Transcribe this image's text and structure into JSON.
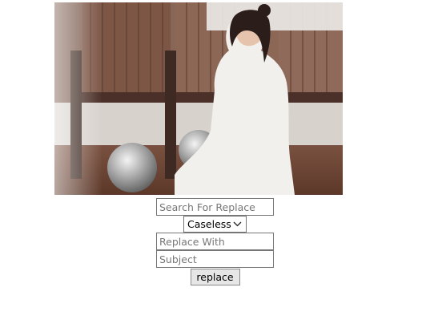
{
  "form": {
    "search_placeholder": "Search For Replace",
    "mode_selected": "Caseless",
    "replace_placeholder": "Replace With",
    "subject_placeholder": "Subject",
    "submit_label": "replace"
  },
  "icons": {
    "dropdown": "chevron-down-icon"
  },
  "colors": {
    "field_border": "#767676",
    "button_bg": "#e6e6e6"
  }
}
